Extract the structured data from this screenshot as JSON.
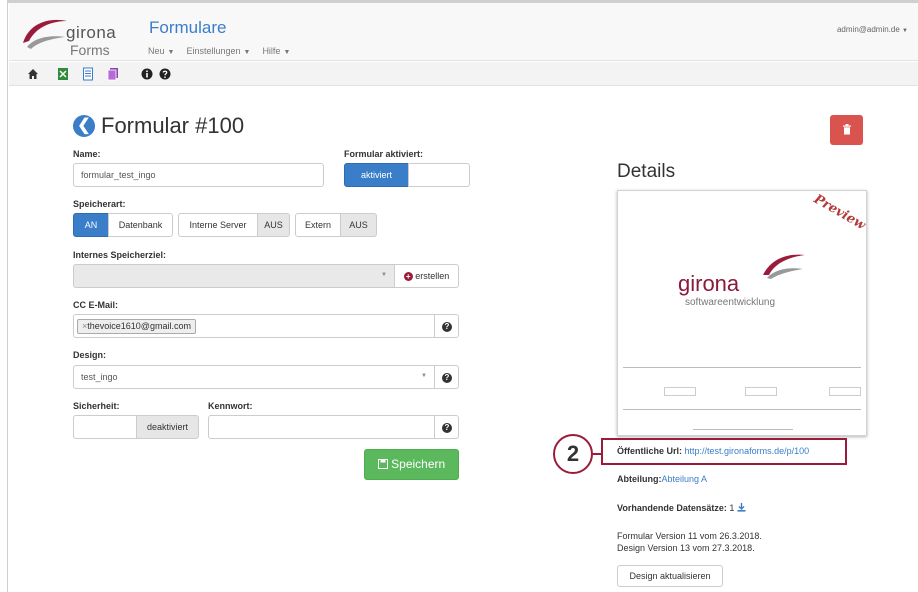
{
  "header": {
    "logo_name": "girona",
    "logo_sub": "Forms",
    "app_title": "Formulare",
    "menu": [
      {
        "label": "Neu"
      },
      {
        "label": "Einstellungen"
      },
      {
        "label": "Hilfe"
      }
    ],
    "user": "admin@admin.de"
  },
  "toolbar": {
    "icons": [
      "home-icon",
      "excel-icon",
      "document-icon",
      "copy-icon",
      "info-icon",
      "help-icon"
    ]
  },
  "form": {
    "title": "Formular #100",
    "name_label": "Name:",
    "name_value": "formular_test_ingo",
    "active_label": "Formular aktiviert:",
    "active_on": "aktiviert",
    "storage_label": "Speicherart:",
    "storage_on": "AN",
    "storage_db": "Datenbank",
    "storage_internal": "Interne Server",
    "storage_internal_off": "AUS",
    "storage_external": "Extern",
    "storage_external_off": "AUS",
    "target_label": "Internes Speicherziel:",
    "create_label": "erstellen",
    "cc_label": "CC E-Mail:",
    "cc_tag": "thevoice1610@gmail.com",
    "design_label": "Design:",
    "design_value": "test_ingo",
    "security_label": "Sicherheit:",
    "security_value": "deaktiviert",
    "password_label": "Kennwort:",
    "save_label": "Speichern"
  },
  "details": {
    "heading": "Details",
    "preview_word": "Preview",
    "preview_brand": "girona",
    "preview_sub": "softwareentwicklung",
    "url_label": "Öffentliche Url:",
    "url_value": "http://test.gironaforms.de/p/100",
    "dept_label": "Abteilung:",
    "dept_value": "Abteilung A",
    "records_label": "Vorhandende Datensätze:",
    "records_value": "1",
    "version_form": "Formular Version 11 vom 26.3.2018.",
    "version_design": "Design Version 13 vom 27.3.2018.",
    "update_label": "Design aktualisieren"
  },
  "annotation": {
    "number": "2"
  },
  "colors": {
    "brand": "#3a7ec9",
    "accent": "#9b1c3a",
    "success": "#5cb85c",
    "danger": "#d9534f"
  }
}
